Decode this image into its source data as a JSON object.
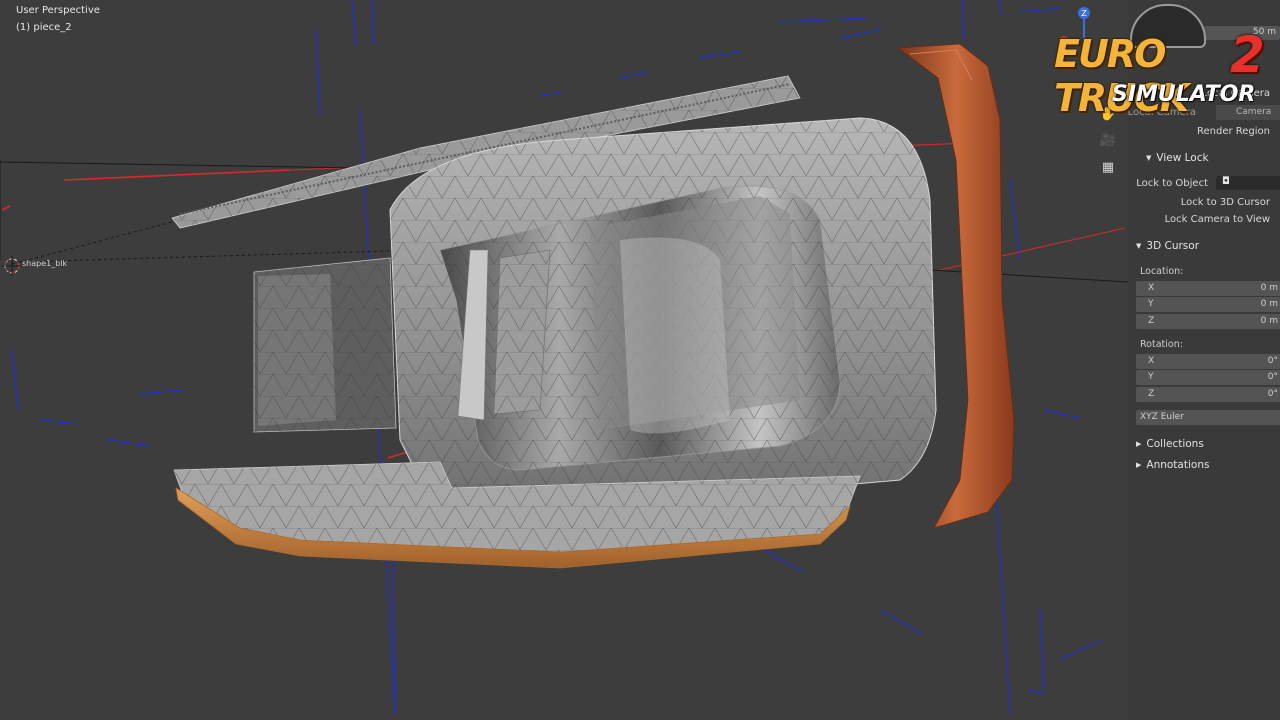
{
  "viewport": {
    "view_name": "User Perspective",
    "object_name": "(1) piece_2",
    "origin_label": "shape1_blk"
  },
  "nav_icons": [
    "hand-icon",
    "camera-icon",
    "grid-icon"
  ],
  "side_panel": {
    "top_value": "50 m",
    "local_camera": "Local Camera",
    "camera_field_label": "Local Camera",
    "camera_value": "Camera",
    "render_region": "Render Region",
    "view_lock": {
      "header": "View Lock",
      "lock_to_object": "Lock to Object",
      "lock_to_cursor": "Lock to 3D Cursor",
      "lock_camera": "Lock Camera to View"
    },
    "cursor": {
      "header": "3D Cursor",
      "location_label": "Location:",
      "location": [
        {
          "axis": "X",
          "value": "0 m"
        },
        {
          "axis": "Y",
          "value": "0 m"
        },
        {
          "axis": "Z",
          "value": "0 m"
        }
      ],
      "rotation_label": "Rotation:",
      "rotation": [
        {
          "axis": "X",
          "value": "0°"
        },
        {
          "axis": "Y",
          "value": "0°"
        },
        {
          "axis": "Z",
          "value": "0°"
        }
      ],
      "rotation_mode": "XYZ Euler"
    },
    "collections": "Collections",
    "annotations": "Annotations"
  },
  "watermark": {
    "line1": "EURO TRUCK",
    "number": "2",
    "line2": "SIMULATOR"
  },
  "colors": {
    "background": "#3d3d3d",
    "panel": "#3a3a3a",
    "x_axis": "#d22b2b",
    "z_axis": "#1f2fd0",
    "mesh": "#a8a8a8",
    "accent_orange": "#c97a36",
    "rust_strip": "#b0502a"
  }
}
